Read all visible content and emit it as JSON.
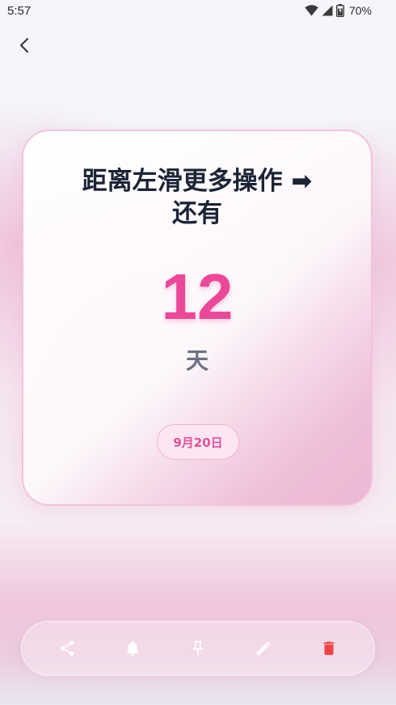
{
  "status_bar": {
    "time": "5:57",
    "battery": "70%"
  },
  "card": {
    "title_line1": "距离左滑更多操作 ➡",
    "title_line2": "还有",
    "days": "12",
    "unit": "天",
    "date": "9月20日"
  },
  "actions": [
    {
      "name": "share",
      "icon": "share-icon"
    },
    {
      "name": "reminder",
      "icon": "bell-icon"
    },
    {
      "name": "pin",
      "icon": "pin-icon"
    },
    {
      "name": "edit",
      "icon": "pencil-icon"
    },
    {
      "name": "delete",
      "icon": "trash-icon"
    }
  ],
  "colors": {
    "accent": "#ec4899",
    "title": "#1c2435",
    "delete": "#ef4444",
    "icon": "#ffffff"
  }
}
